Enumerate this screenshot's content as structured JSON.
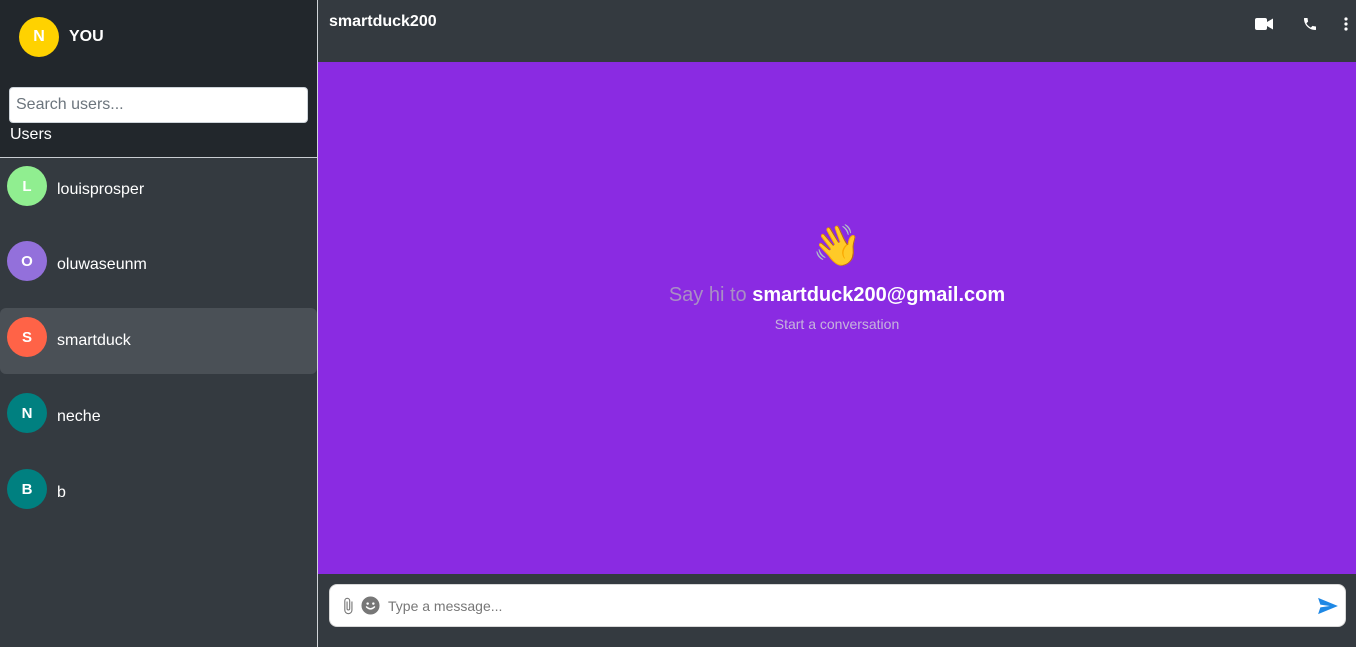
{
  "me": {
    "initial": "N",
    "name": "YOU",
    "avatar_color": "#ffd200"
  },
  "search": {
    "placeholder": "Search users...",
    "value": ""
  },
  "users_label": "Users",
  "users": [
    {
      "initial": "L",
      "name": "louisprosper",
      "color": "#90ee90",
      "active": false
    },
    {
      "initial": "O",
      "name": "oluwaseunm",
      "color": "#9370db",
      "active": false
    },
    {
      "initial": "S",
      "name": "smartduck",
      "color": "#ff6347",
      "active": true
    },
    {
      "initial": "N",
      "name": "neche",
      "color": "#008080",
      "active": false
    },
    {
      "initial": "B",
      "name": "b",
      "color": "#008080",
      "active": false
    }
  ],
  "chat": {
    "title": "smartduck200",
    "wave_emoji": "👋",
    "say_hi_prefix": "Say hi to",
    "email": "smartduck200@gmail.com",
    "subtitle": "Start a conversation",
    "background": "#8a2be2"
  },
  "toolbar_icons": [
    "video-camera-icon",
    "phone-icon",
    "more-vertical-icon"
  ],
  "composer": {
    "placeholder": "Type a message...",
    "value": "",
    "attach_icon": "paperclip-icon",
    "emoji_icon": "smiley-icon",
    "send_icon": "send-icon",
    "send_color": "#1e88e5"
  }
}
